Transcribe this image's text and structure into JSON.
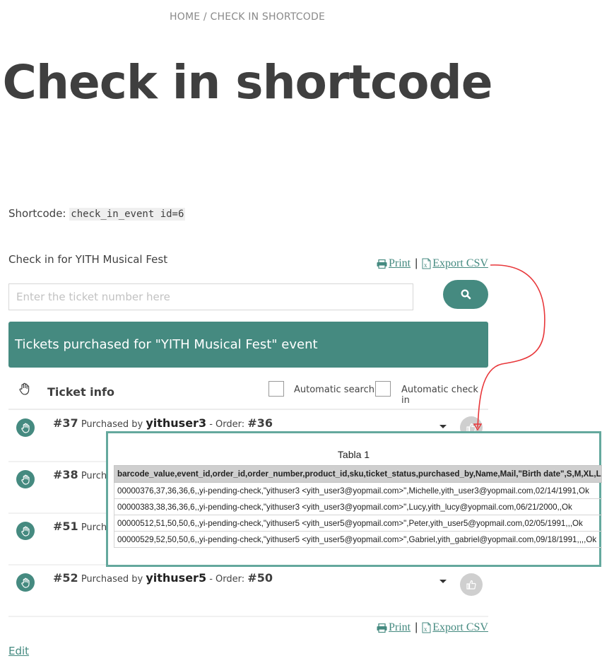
{
  "breadcrumb": "HOME / CHECK IN SHORTCODE",
  "page_title": "Check in shortcode",
  "shortcode": {
    "label": "Shortcode:",
    "code": "check_in_event id=6"
  },
  "event_heading": "Check in for YITH Musical Fest",
  "actions": {
    "print_label": "Print",
    "separator": "|",
    "export_label": "Export CSV"
  },
  "search": {
    "placeholder": "Enter the ticket number here",
    "value": "",
    "button_icon": "search-icon"
  },
  "tickets_header": "Tickets purchased for \"YITH Musical Fest\" event",
  "columns": {
    "ticket_info": "Ticket info",
    "automatic_search": "Automatic search",
    "automatic_check_in": "Automatic check in"
  },
  "tickets": [
    {
      "number": "#37",
      "purchased_by_label": "Purchased by",
      "user": "yithuser3",
      "order_label": "- Order:",
      "order": "#36"
    },
    {
      "number": "#38",
      "purchased_by_label": "Purcha",
      "user": "",
      "order_label": "",
      "order": ""
    },
    {
      "number": "#51",
      "purchased_by_label": "Purcha",
      "user": "",
      "order_label": "",
      "order": ""
    },
    {
      "number": "#52",
      "purchased_by_label": "Purchased by",
      "user": "yithuser5",
      "order_label": "- Order:",
      "order": "#50"
    }
  ],
  "edit_label": "Edit",
  "csv_preview": {
    "title": "Tabla 1",
    "header": "barcode_value,event_id,order_id,order_number,product_id,sku,ticket_status,purchased_by,Name,Mail,\"Birth date\",S,M,XL,L",
    "rows": [
      "00000376,37,36,36,6,,yi-pending-check,\"yithuser3 <yith_user3@yopmail.com>\",Michelle,yith_user3@yopmail.com,02/14/1991,Ok",
      "00000383,38,36,36,6,,yi-pending-check,\"yithuser3 <yith_user3@yopmail.com>\",Lucy,yith_lucy@yopmail.com,06/21/2000,,Ok",
      "00000512,51,50,50,6,,yi-pending-check,\"yithuser5 <yith_user5@yopmail.com>\",Peter,yith_user5@yopmail.com,02/05/1991,,,Ok",
      "00000529,52,50,50,6,,yi-pending-check,\"yithuser5 <yith_user5@yopmail.com>\",Gabriel,yith_gabriel@yopmail.com,09/18/1991,,,,Ok"
    ]
  },
  "colors": {
    "accent": "#458a80",
    "overlay_border": "#64a89d",
    "annotation_arrow": "#e8373a",
    "thumb_inactive": "#cfcfcf"
  }
}
